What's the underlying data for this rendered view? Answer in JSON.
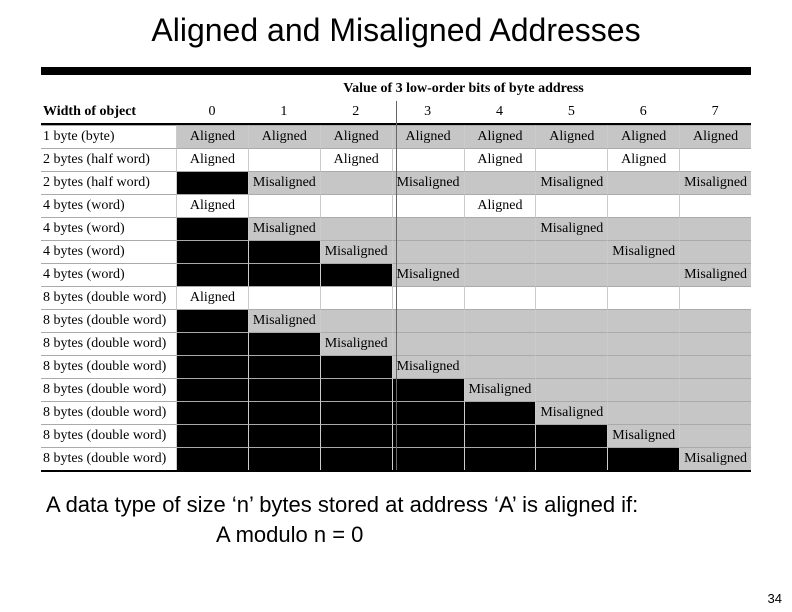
{
  "title": "Aligned and Misaligned Addresses",
  "table_title": "Value of 3 low-order bits of byte address",
  "leader": "Width of object",
  "cols": [
    "0",
    "1",
    "2",
    "3",
    "4",
    "5",
    "6",
    "7"
  ],
  "rows": [
    {
      "label": "1 byte (byte)",
      "cells": [
        {
          "t": "Aligned",
          "c": "g"
        },
        {
          "t": "Aligned",
          "c": "g"
        },
        {
          "t": "Aligned",
          "c": "g"
        },
        {
          "t": "Aligned",
          "c": "g"
        },
        {
          "t": "Aligned",
          "c": "g"
        },
        {
          "t": "Aligned",
          "c": "g"
        },
        {
          "t": "Aligned",
          "c": "g"
        },
        {
          "t": "Aligned",
          "c": "g"
        }
      ]
    },
    {
      "label": "2 bytes (half word)",
      "cells": [
        {
          "t": "Aligned",
          "c": "w"
        },
        {
          "t": "",
          "c": "w"
        },
        {
          "t": "Aligned",
          "c": "w"
        },
        {
          "t": "",
          "c": "w"
        },
        {
          "t": "Aligned",
          "c": "w"
        },
        {
          "t": "",
          "c": "w"
        },
        {
          "t": "Aligned",
          "c": "w"
        },
        {
          "t": "",
          "c": "w"
        }
      ]
    },
    {
      "label": "2 bytes (half word)",
      "cells": [
        {
          "t": "",
          "c": "b"
        },
        {
          "t": "Misaligned",
          "c": "g"
        },
        {
          "t": "",
          "c": "g"
        },
        {
          "t": "Misaligned",
          "c": "g"
        },
        {
          "t": "",
          "c": "g"
        },
        {
          "t": "Misaligned",
          "c": "g"
        },
        {
          "t": "",
          "c": "g"
        },
        {
          "t": "Misaligned",
          "c": "g"
        }
      ]
    },
    {
      "label": "4 bytes (word)",
      "cells": [
        {
          "t": "Aligned",
          "c": "w"
        },
        {
          "t": "",
          "c": "w"
        },
        {
          "t": "",
          "c": "w"
        },
        {
          "t": "",
          "c": "w"
        },
        {
          "t": "Aligned",
          "c": "w"
        },
        {
          "t": "",
          "c": "w"
        },
        {
          "t": "",
          "c": "w"
        },
        {
          "t": "",
          "c": "w"
        }
      ]
    },
    {
      "label": "4 bytes (word)",
      "cells": [
        {
          "t": "",
          "c": "b"
        },
        {
          "t": "Misaligned",
          "c": "g"
        },
        {
          "t": "",
          "c": "g"
        },
        {
          "t": "",
          "c": "g"
        },
        {
          "t": "",
          "c": "g"
        },
        {
          "t": "Misaligned",
          "c": "g"
        },
        {
          "t": "",
          "c": "g"
        },
        {
          "t": "",
          "c": "g"
        }
      ]
    },
    {
      "label": "4 bytes (word)",
      "cells": [
        {
          "t": "",
          "c": "b"
        },
        {
          "t": "",
          "c": "b"
        },
        {
          "t": "Misaligned",
          "c": "g"
        },
        {
          "t": "",
          "c": "g"
        },
        {
          "t": "",
          "c": "g"
        },
        {
          "t": "",
          "c": "g"
        },
        {
          "t": "Misaligned",
          "c": "g"
        },
        {
          "t": "",
          "c": "g"
        }
      ]
    },
    {
      "label": "4 bytes (word)",
      "cells": [
        {
          "t": "",
          "c": "b"
        },
        {
          "t": "",
          "c": "b"
        },
        {
          "t": "",
          "c": "b"
        },
        {
          "t": "Misaligned",
          "c": "g"
        },
        {
          "t": "",
          "c": "g"
        },
        {
          "t": "",
          "c": "g"
        },
        {
          "t": "",
          "c": "g"
        },
        {
          "t": "Misaligned",
          "c": "g"
        }
      ]
    },
    {
      "label": "8 bytes (double word)",
      "cells": [
        {
          "t": "Aligned",
          "c": "w"
        },
        {
          "t": "",
          "c": "w"
        },
        {
          "t": "",
          "c": "w"
        },
        {
          "t": "",
          "c": "w"
        },
        {
          "t": "",
          "c": "w"
        },
        {
          "t": "",
          "c": "w"
        },
        {
          "t": "",
          "c": "w"
        },
        {
          "t": "",
          "c": "w"
        }
      ]
    },
    {
      "label": "8 bytes (double word)",
      "cells": [
        {
          "t": "",
          "c": "b"
        },
        {
          "t": "Misaligned",
          "c": "g"
        },
        {
          "t": "",
          "c": "g"
        },
        {
          "t": "",
          "c": "g"
        },
        {
          "t": "",
          "c": "g"
        },
        {
          "t": "",
          "c": "g"
        },
        {
          "t": "",
          "c": "g"
        },
        {
          "t": "",
          "c": "g"
        }
      ]
    },
    {
      "label": "8 bytes (double word)",
      "cells": [
        {
          "t": "",
          "c": "b"
        },
        {
          "t": "",
          "c": "b"
        },
        {
          "t": "Misaligned",
          "c": "g"
        },
        {
          "t": "",
          "c": "g"
        },
        {
          "t": "",
          "c": "g"
        },
        {
          "t": "",
          "c": "g"
        },
        {
          "t": "",
          "c": "g"
        },
        {
          "t": "",
          "c": "g"
        }
      ]
    },
    {
      "label": "8 bytes (double word)",
      "cells": [
        {
          "t": "",
          "c": "b"
        },
        {
          "t": "",
          "c": "b"
        },
        {
          "t": "",
          "c": "b"
        },
        {
          "t": "Misaligned",
          "c": "g"
        },
        {
          "t": "",
          "c": "g"
        },
        {
          "t": "",
          "c": "g"
        },
        {
          "t": "",
          "c": "g"
        },
        {
          "t": "",
          "c": "g"
        }
      ]
    },
    {
      "label": "8 bytes (double word)",
      "cells": [
        {
          "t": "",
          "c": "b"
        },
        {
          "t": "",
          "c": "b"
        },
        {
          "t": "",
          "c": "b"
        },
        {
          "t": "",
          "c": "b"
        },
        {
          "t": "Misaligned",
          "c": "g"
        },
        {
          "t": "",
          "c": "g"
        },
        {
          "t": "",
          "c": "g"
        },
        {
          "t": "",
          "c": "g"
        }
      ]
    },
    {
      "label": "8 bytes (double word)",
      "cells": [
        {
          "t": "",
          "c": "b"
        },
        {
          "t": "",
          "c": "b"
        },
        {
          "t": "",
          "c": "b"
        },
        {
          "t": "",
          "c": "b"
        },
        {
          "t": "",
          "c": "b"
        },
        {
          "t": "Misaligned",
          "c": "g"
        },
        {
          "t": "",
          "c": "g"
        },
        {
          "t": "",
          "c": "g"
        }
      ]
    },
    {
      "label": "8 bytes (double word)",
      "cells": [
        {
          "t": "",
          "c": "b"
        },
        {
          "t": "",
          "c": "b"
        },
        {
          "t": "",
          "c": "b"
        },
        {
          "t": "",
          "c": "b"
        },
        {
          "t": "",
          "c": "b"
        },
        {
          "t": "",
          "c": "b"
        },
        {
          "t": "Misaligned",
          "c": "g"
        },
        {
          "t": "",
          "c": "g"
        }
      ]
    },
    {
      "label": "8 bytes (double word)",
      "cells": [
        {
          "t": "",
          "c": "b"
        },
        {
          "t": "",
          "c": "b"
        },
        {
          "t": "",
          "c": "b"
        },
        {
          "t": "",
          "c": "b"
        },
        {
          "t": "",
          "c": "b"
        },
        {
          "t": "",
          "c": "b"
        },
        {
          "t": "",
          "c": "b"
        },
        {
          "t": "Misaligned",
          "c": "g"
        }
      ]
    }
  ],
  "caption_line1": "A data type of size ‘n’ bytes stored at address ‘A’ is aligned if:",
  "caption_line2": "A modulo n = 0",
  "page": "34"
}
